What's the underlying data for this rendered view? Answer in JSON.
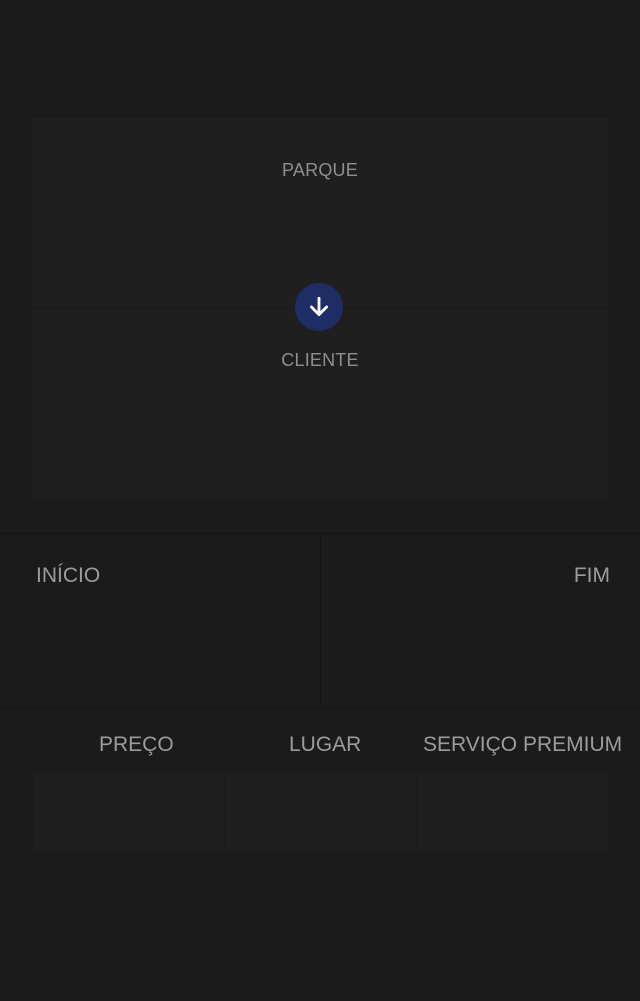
{
  "route": {
    "origin_label": "PARQUE",
    "destination_label": "CLIENTE",
    "swap_icon": "arrow-down-icon",
    "swap_color": "#1f2d66"
  },
  "dates": {
    "start_label": "INÍCIO",
    "end_label": "FIM"
  },
  "options": {
    "price_label": "PREÇO",
    "place_label": "LUGAR",
    "premium_label": "SERVIÇO PREMIUM"
  },
  "colors": {
    "background": "#1b1b1b",
    "card": "#1f1f1f",
    "text": "#9a9a9a"
  }
}
